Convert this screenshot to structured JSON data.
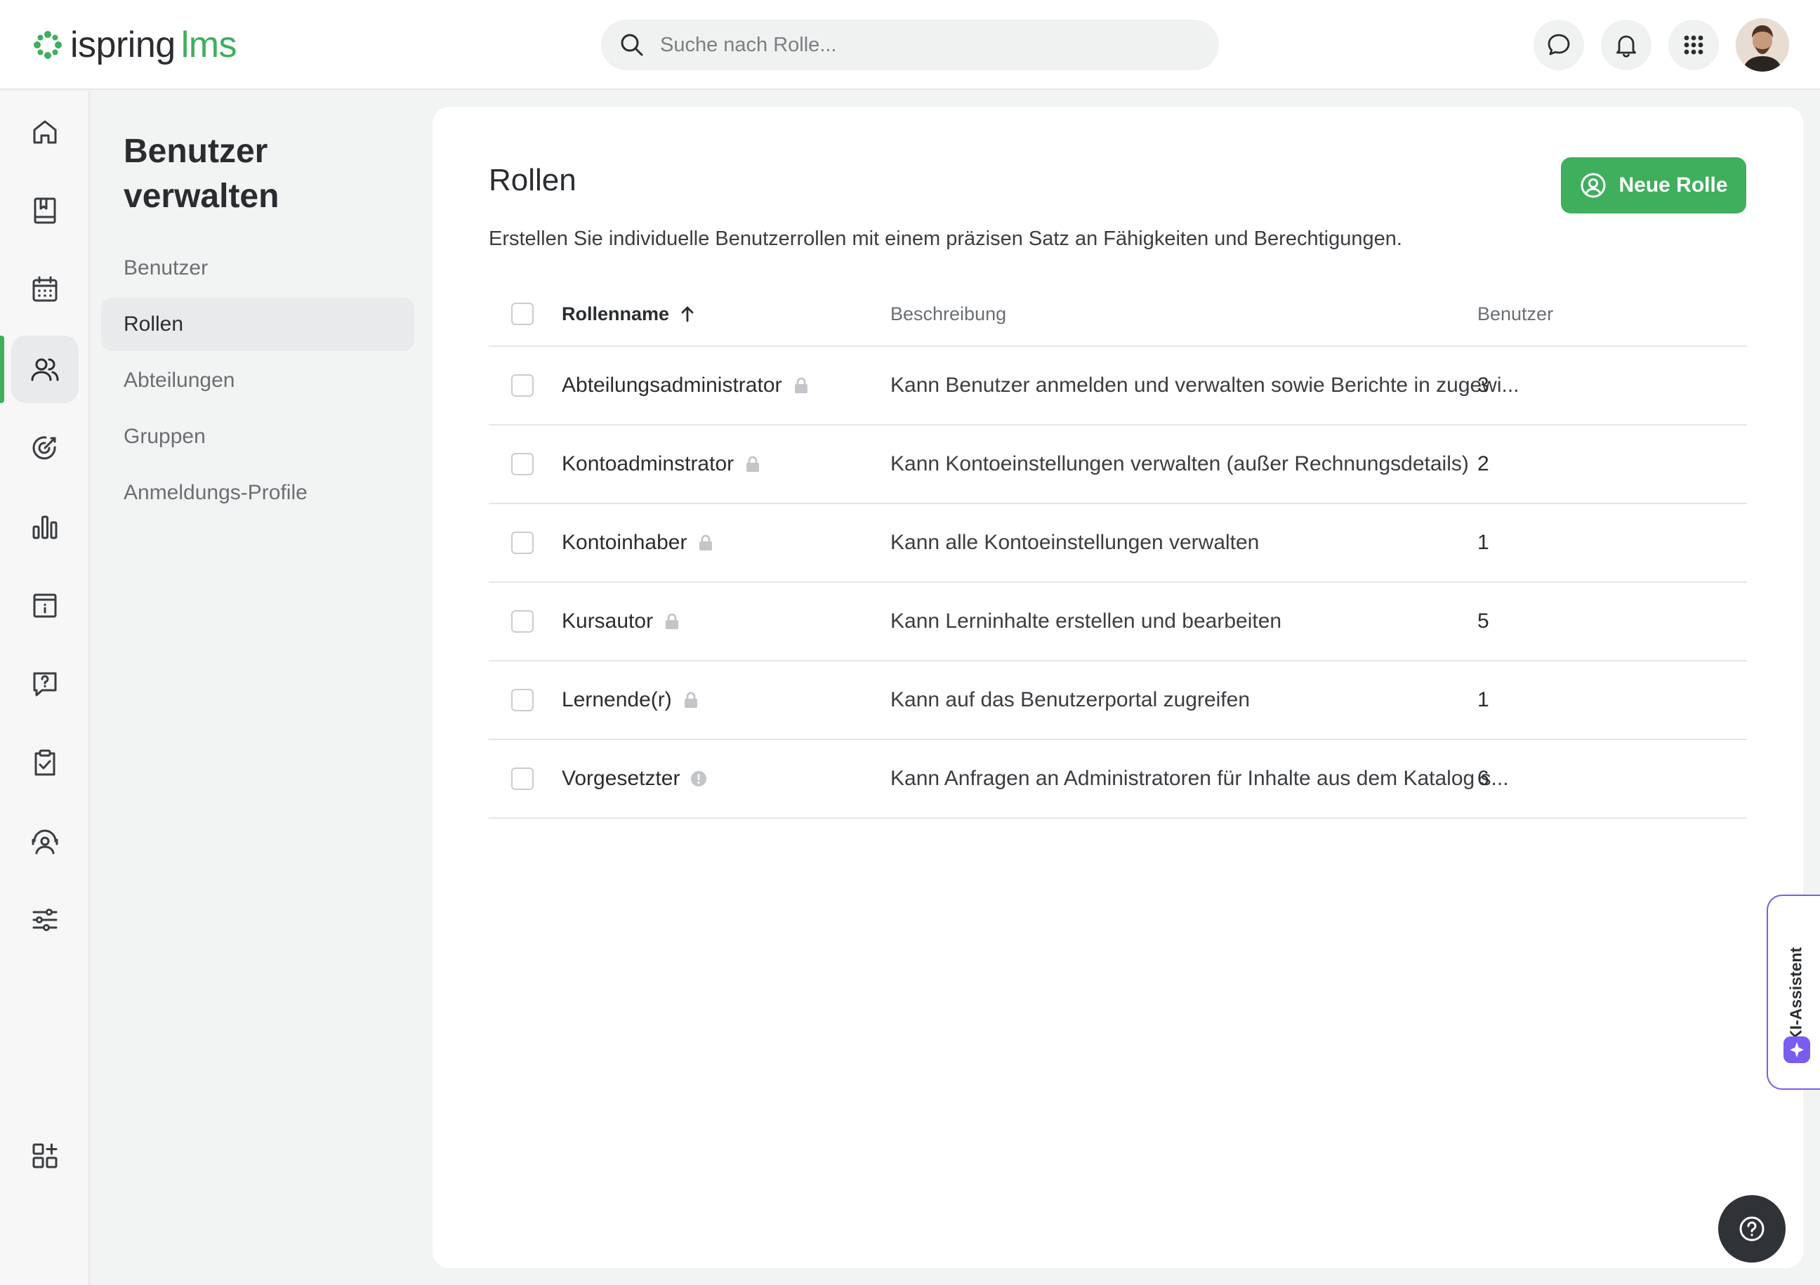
{
  "header": {
    "logo_main": "ispring",
    "logo_accent": "lms",
    "search_placeholder": "Suche nach Rolle..."
  },
  "icons": {
    "rail": [
      "home-icon",
      "book-icon",
      "calendar-icon",
      "users-icon",
      "target-icon",
      "bar-chart-icon",
      "info-board-icon",
      "question-icon",
      "clipboard-check-icon",
      "support-agent-icon",
      "sliders-icon",
      "add-widget-icon"
    ],
    "header": [
      "chat-icon",
      "bell-icon",
      "apps-grid-icon"
    ]
  },
  "subnav": {
    "title": "Benutzer verwalten",
    "items": [
      {
        "label": "Benutzer",
        "active": false
      },
      {
        "label": "Rollen",
        "active": true
      },
      {
        "label": "Abteilungen",
        "active": false
      },
      {
        "label": "Gruppen",
        "active": false
      },
      {
        "label": "Anmeldungs-Profile",
        "active": false
      }
    ]
  },
  "main": {
    "title": "Rollen",
    "description": "Erstellen Sie individuelle Benutzerrollen mit einem präzisen Satz an Fähigkeiten und Berechtigungen.",
    "new_role_label": "Neue Rolle",
    "table": {
      "headers": {
        "name": "Rollenname",
        "description": "Beschreibung",
        "users": "Benutzer"
      },
      "rows": [
        {
          "name": "Abteilungsadministrator",
          "icon": "lock-icon",
          "description": "Kann Benutzer anmelden und verwalten sowie Berichte in zugewi...",
          "users": "3"
        },
        {
          "name": "Kontoadminstrator",
          "icon": "lock-icon",
          "description": "Kann Kontoeinstellungen verwalten (außer Rechnungsdetails)",
          "users": "2"
        },
        {
          "name": "Kontoinhaber",
          "icon": "lock-icon",
          "description": "Kann alle Kontoeinstellungen verwalten",
          "users": "1"
        },
        {
          "name": "Kursautor",
          "icon": "lock-icon",
          "description": "Kann Lerninhalte erstellen und bearbeiten",
          "users": "5"
        },
        {
          "name": "Lernende(r)",
          "icon": "lock-icon",
          "description": "Kann auf das Benutzerportal zugreifen",
          "users": "1"
        },
        {
          "name": "Vorgesetzter",
          "icon": "alert-icon",
          "description": "Kann Anfragen an Administratoren für Inhalte aus dem Katalog s...",
          "users": "6"
        }
      ]
    }
  },
  "ai_assistant": {
    "label": "KI-Assistent"
  },
  "colors": {
    "accent": "#3fae5d",
    "ai": "#7a5cf0"
  }
}
